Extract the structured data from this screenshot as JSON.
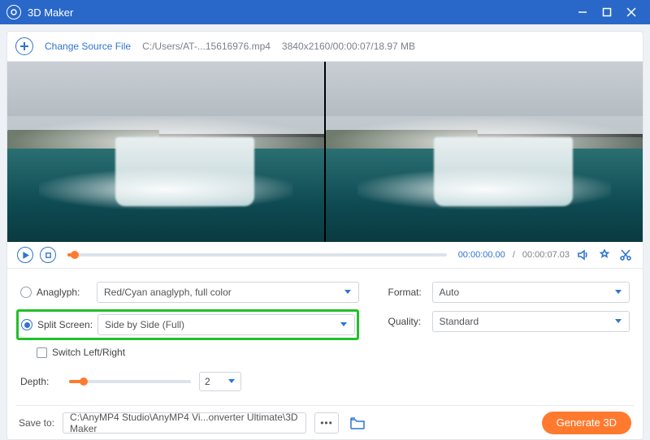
{
  "titlebar": {
    "title": "3D Maker"
  },
  "topbar": {
    "change_label": "Change Source File",
    "file_path": "C:/Users/AT-...15616976.mp4",
    "file_meta": "3840x2160/00:00:07/18.97 MB"
  },
  "playbar": {
    "current_time": "00:00:00.00",
    "total_time": "00:00:07.03"
  },
  "options": {
    "anaglyph": {
      "label": "Anaglyph:",
      "value": "Red/Cyan anaglyph, full color",
      "selected": false
    },
    "splitscreen": {
      "label": "Split Screen:",
      "value": "Side by Side (Full)",
      "selected": true
    },
    "switch_label": "Switch Left/Right",
    "depth": {
      "label": "Depth:",
      "value": "2",
      "percent": 12
    },
    "format": {
      "label": "Format:",
      "value": "Auto"
    },
    "quality": {
      "label": "Quality:",
      "value": "Standard"
    }
  },
  "bottombar": {
    "save_label": "Save to:",
    "save_path": "C:\\AnyMP4 Studio\\AnyMP4 Vi...onverter Ultimate\\3D Maker",
    "generate_label": "Generate 3D"
  }
}
